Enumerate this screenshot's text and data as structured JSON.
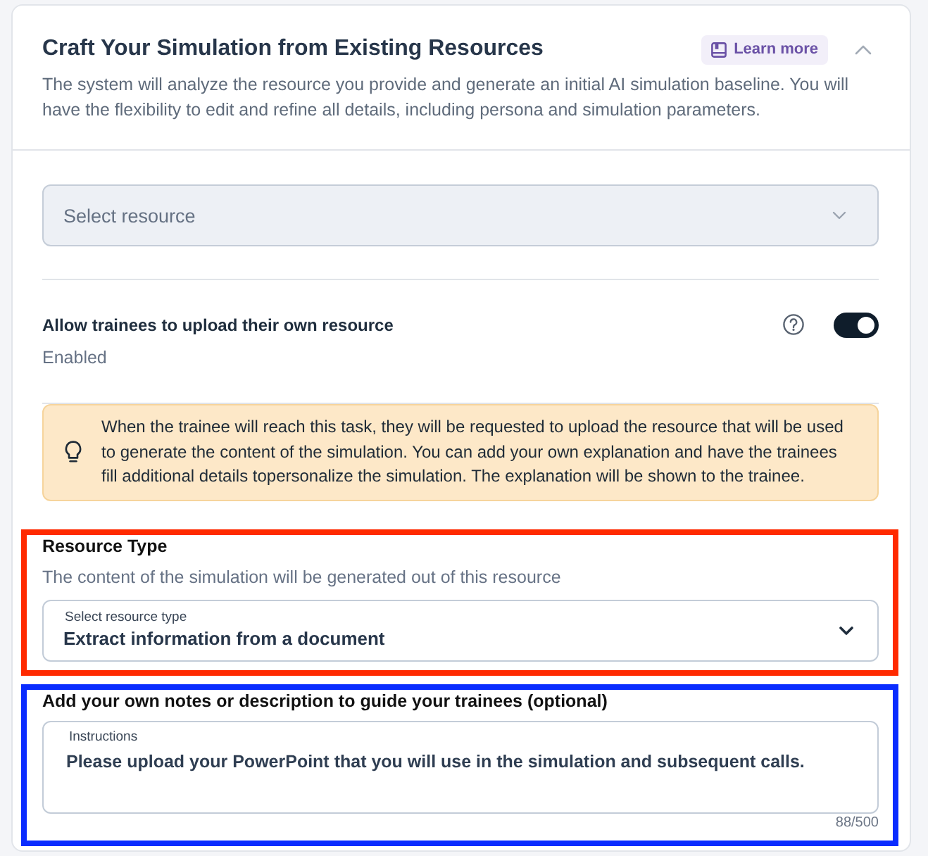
{
  "header": {
    "title": "Craft Your Simulation from Existing Resources",
    "learn_more": "Learn more",
    "expanded": true,
    "description": "The system will analyze the resource you provide and generate an initial AI simulation baseline. You will have the flexibility to edit and refine all details, including persona and simulation parameters."
  },
  "resource_select": {
    "placeholder": "Select resource"
  },
  "upload_setting": {
    "label": "Allow trainees to upload their own resource",
    "status": "Enabled",
    "on": true
  },
  "info_note": {
    "text": "When the trainee will reach this task, they will be requested to upload the resource that will be used to generate the content of the simulation. You can add your own explanation and have the trainees fill additional details topersonalize the simulation. The explanation will be shown to the trainee."
  },
  "sections": [
    {
      "kind": "select",
      "color": "#ff2a00",
      "title": "Resource Type",
      "subtitle": "The content of the simulation will be generated out of this resource",
      "field": {
        "label": "Select resource type",
        "value": "Extract information from a document"
      }
    },
    {
      "kind": "textarea",
      "color": "#0a2cff",
      "title": "Add your own notes or description to guide your trainees (optional)",
      "field": {
        "label": "Instructions",
        "value": "Please upload your PowerPoint that you will use in the simulation and subsequent calls.",
        "counter": "88/500"
      }
    }
  ]
}
